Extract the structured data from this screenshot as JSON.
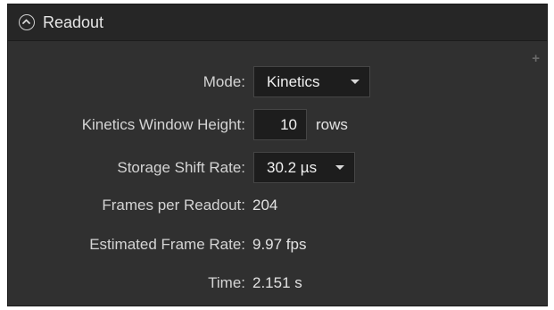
{
  "panel": {
    "title": "Readout",
    "collapse_icon": "chevron-up-icon",
    "add_icon": "plus-icon"
  },
  "fields": {
    "mode": {
      "label": "Mode:",
      "value": "Kinetics"
    },
    "kinetics_window_height": {
      "label": "Kinetics Window Height:",
      "value": "10",
      "unit": "rows"
    },
    "storage_shift_rate": {
      "label": "Storage Shift Rate:",
      "value": "30.2 µs"
    },
    "frames_per_readout": {
      "label": "Frames per Readout:",
      "value": "204"
    },
    "estimated_frame_rate": {
      "label": "Estimated Frame Rate:",
      "value": "9.97 fps"
    },
    "time": {
      "label": "Time:",
      "value": "2.151 s"
    }
  }
}
